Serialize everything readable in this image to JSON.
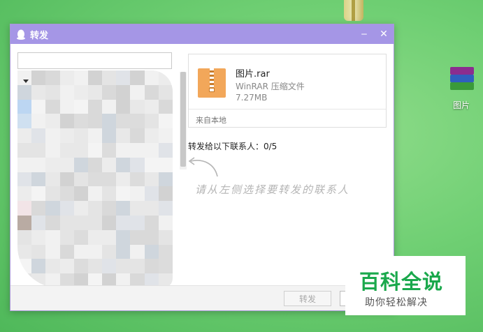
{
  "window": {
    "title": "转发"
  },
  "window_controls": {
    "minimize": "‒",
    "close": "✕"
  },
  "search": {
    "value": "",
    "placeholder": ""
  },
  "file": {
    "name": "图片.rar",
    "type": "WinRAR 压缩文件",
    "size": "7.27MB",
    "source": "来自本地"
  },
  "contacts": {
    "selected_label": "转发给以下联系人：0/5"
  },
  "hint": {
    "text": "请从左侧选择要转发的联系人"
  },
  "footer": {
    "send_label": "转发",
    "cancel_label": ""
  },
  "desktop": {
    "file_label": "图片"
  },
  "watermark": {
    "title": "百科全说",
    "subtitle": "助你轻松解决"
  },
  "colors": {
    "titlebar": "#a596e6",
    "file_icon": "#f2a75a",
    "desktop_bg": "#6fcf73",
    "watermark_green": "#1aa84c"
  },
  "icons": [
    "qq-penguin-icon",
    "minimize-icon",
    "close-icon",
    "zip-file-icon",
    "winrar-file-icon",
    "hint-arrow-icon"
  ]
}
